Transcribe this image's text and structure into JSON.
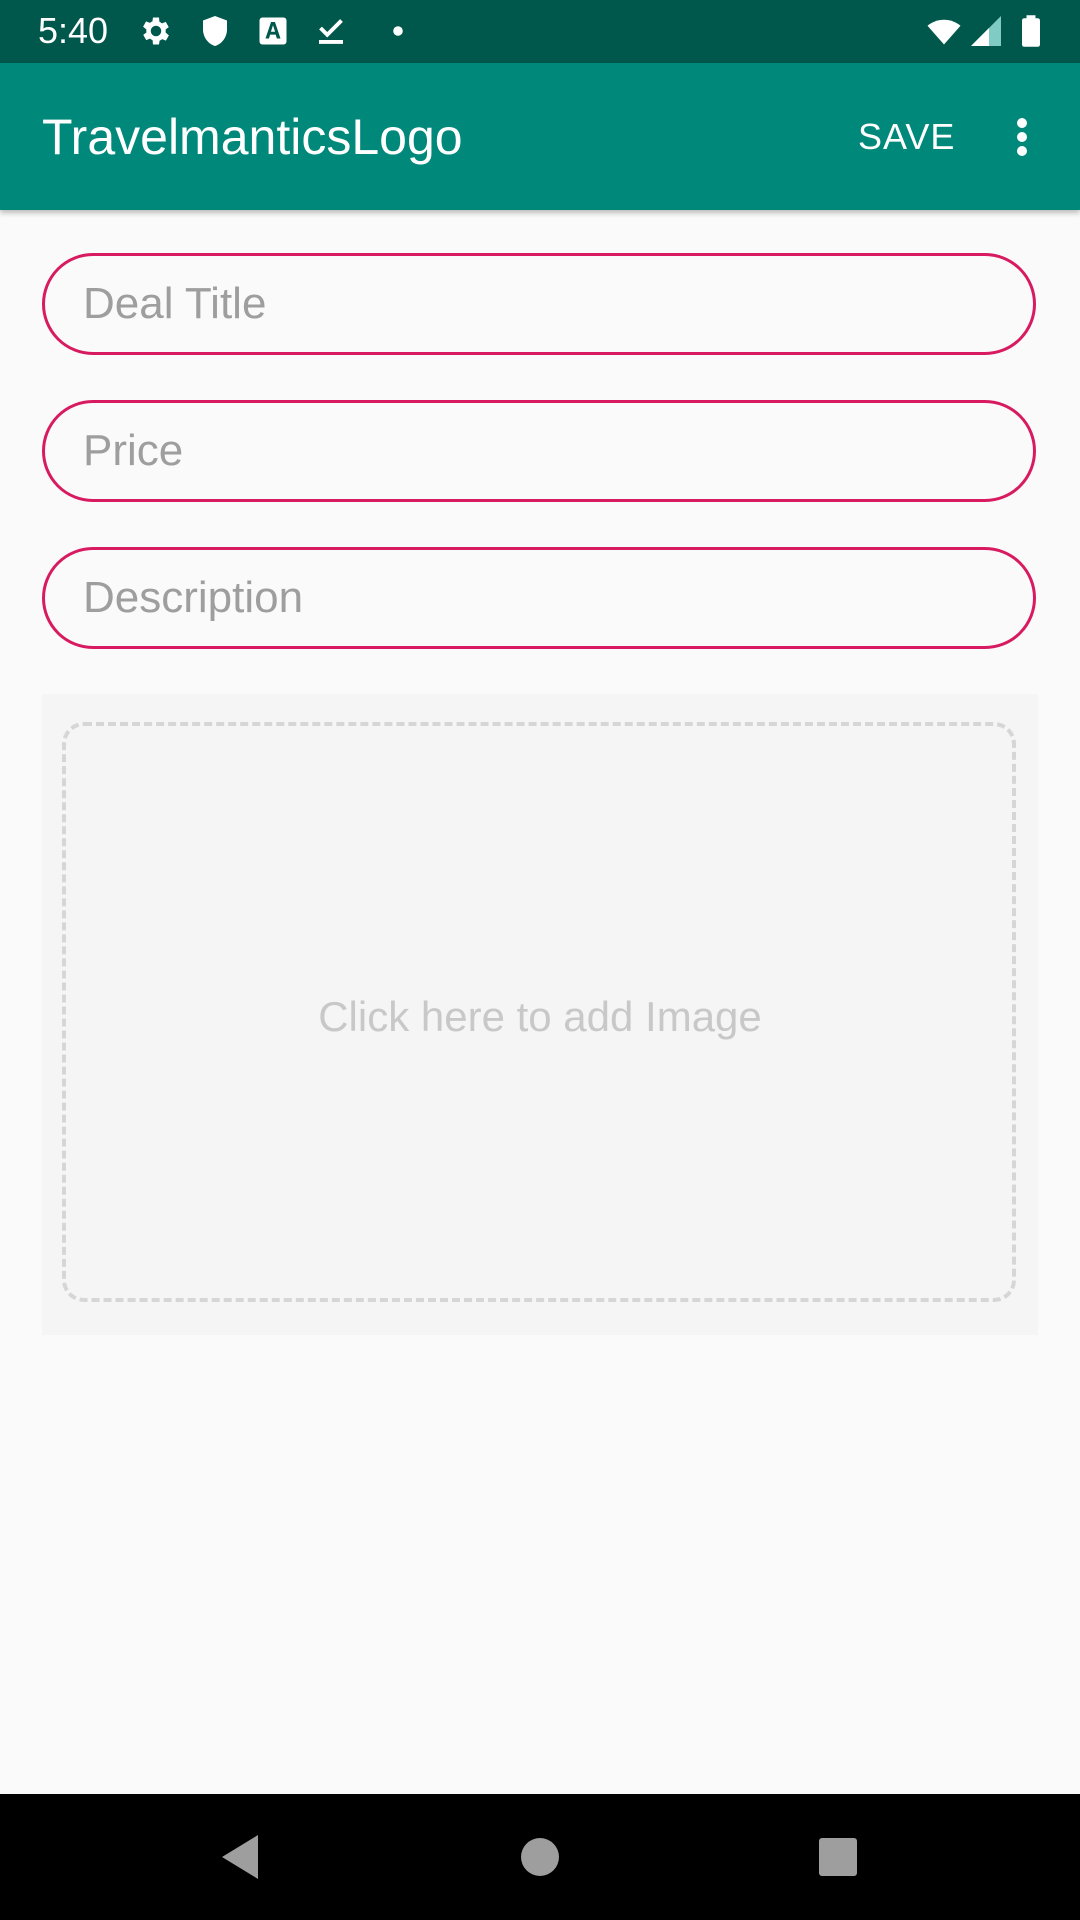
{
  "status_bar": {
    "time": "5:40",
    "icons_left": [
      "settings-icon",
      "shield-icon",
      "font-a-icon",
      "download-check-icon",
      "dot-icon"
    ],
    "icons_right": [
      "wifi-icon",
      "cellular-signal-icon",
      "battery-icon"
    ]
  },
  "app_bar": {
    "title": "TravelmanticsLogo",
    "save_label": "SAVE",
    "overflow_icon": "more-vertical-icon"
  },
  "form": {
    "title_placeholder": "Deal Title",
    "price_placeholder": "Price",
    "description_placeholder": "Description",
    "image_prompt": "Click here to add Image"
  },
  "nav_bar": {
    "buttons": [
      "back-icon",
      "home-icon",
      "recents-icon"
    ]
  },
  "colors": {
    "status_bar": "#00574b",
    "app_bar": "#00897b",
    "accent": "#d81b60",
    "placeholder": "#9e9e9e",
    "background": "#fafafa"
  }
}
